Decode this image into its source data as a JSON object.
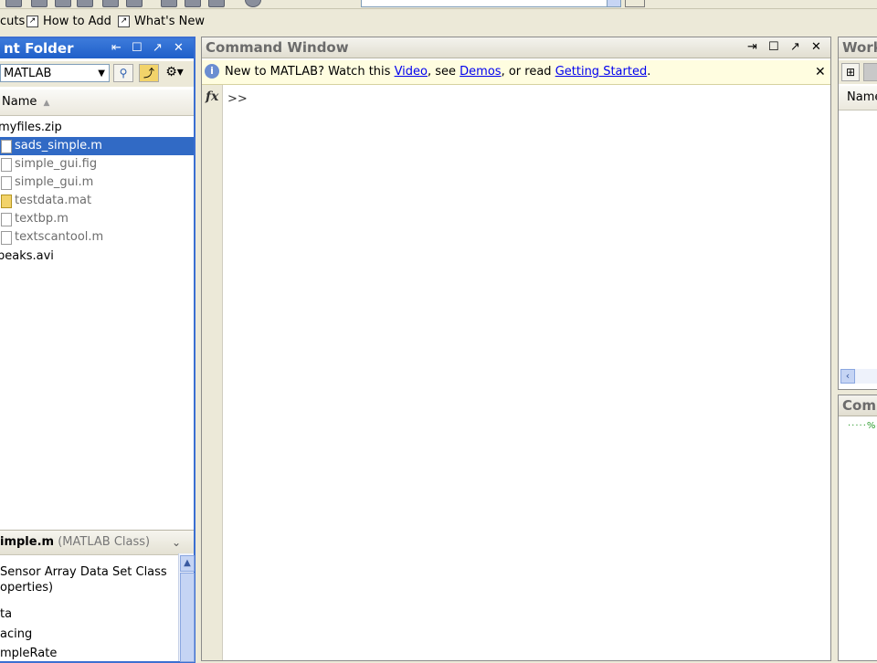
{
  "shortcuts": {
    "items": [
      {
        "label": "cuts"
      },
      {
        "label": "How to Add"
      },
      {
        "label": "What's New"
      }
    ]
  },
  "current_folder": {
    "title": "nt Folder",
    "path": "MATLAB",
    "column_header": "Name",
    "files": [
      {
        "name": "myfiles.zip",
        "state": "normal"
      },
      {
        "name": "sads_simple.m",
        "state": "selected"
      },
      {
        "name": "simple_gui.fig",
        "state": "dim"
      },
      {
        "name": "simple_gui.m",
        "state": "dim"
      },
      {
        "name": "testdata.mat",
        "state": "dim"
      },
      {
        "name": "textbp.m",
        "state": "dim"
      },
      {
        "name": "textscantool.m",
        "state": "dim"
      },
      {
        "name": "peaks.avi",
        "state": "normal"
      }
    ],
    "detail": {
      "file": "imple.m",
      "kind": "(MATLAB Class)",
      "lines": [
        "Sensor Array Data Set Class",
        "operties)",
        "ta",
        "acing",
        "mpleRate"
      ]
    }
  },
  "command_window": {
    "title": "Command Window",
    "banner": {
      "prefix": "New to MATLAB? Watch this ",
      "video": "Video",
      "mid1": ", see ",
      "demos": "Demos",
      "mid2": ", or read ",
      "getting_started": "Getting Started",
      "suffix": "."
    },
    "prompt": ">>"
  },
  "workspace": {
    "title": "Work",
    "column_header": "Name"
  },
  "command_history": {
    "title": "Comm",
    "entry": "·····%–"
  },
  "colors": {
    "title_active": "#2b6bd6",
    "selection": "#316ac5",
    "banner_bg": "#fffde0",
    "link": "#0000ee"
  }
}
